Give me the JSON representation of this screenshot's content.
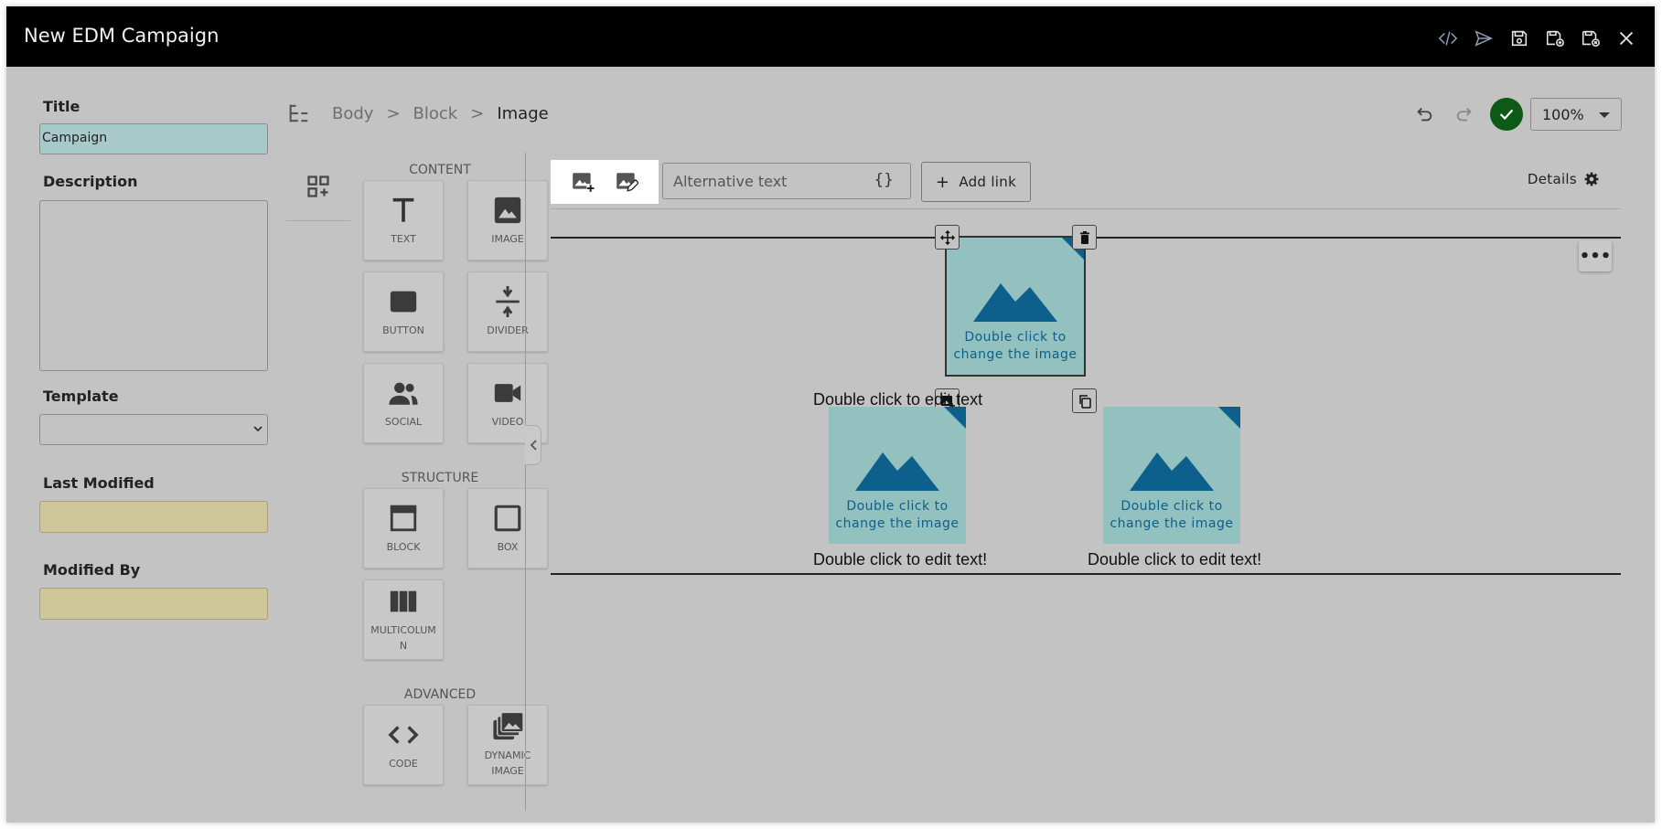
{
  "window": {
    "title": "New EDM Campaign"
  },
  "titlebar_icons": [
    "code-icon",
    "send-icon",
    "save-icon",
    "save-as-icon",
    "save-close-icon",
    "close-icon"
  ],
  "form": {
    "title_label": "Title",
    "title_value": "Campaign",
    "description_label": "Description",
    "description_value": "",
    "template_label": "Template",
    "template_value": "",
    "last_modified_label": "Last Modified",
    "last_modified_value": "",
    "modified_by_label": "Modified By",
    "modified_by_value": ""
  },
  "breadcrumb": {
    "items": [
      "Body",
      "Block",
      "Image"
    ],
    "separator": ">"
  },
  "zoom": {
    "value": "100%"
  },
  "palette": {
    "content_title": "CONTENT",
    "structure_title": "STRUCTURE",
    "advanced_title": "ADVANCED",
    "content": [
      {
        "label": "TEXT",
        "icon": "text-icon"
      },
      {
        "label": "IMAGE",
        "icon": "image-icon"
      },
      {
        "label": "BUTTON",
        "icon": "button-icon"
      },
      {
        "label": "DIVIDER",
        "icon": "divider-icon"
      },
      {
        "label": "SOCIAL",
        "icon": "social-icon"
      },
      {
        "label": "VIDEO",
        "icon": "video-icon"
      }
    ],
    "structure": [
      {
        "label": "BLOCK",
        "icon": "block-icon"
      },
      {
        "label": "BOX",
        "icon": "box-icon"
      },
      {
        "label": "MULTICOLUM",
        "label2": "N",
        "icon": "multicolumn-icon"
      }
    ],
    "advanced": [
      {
        "label": "CODE",
        "icon": "code-icon"
      },
      {
        "label": "DYNAMIC",
        "label2": "IMAGE",
        "icon": "dynamic-image-icon"
      }
    ]
  },
  "image_toolbar": {
    "alt_placeholder": "Alternative text",
    "braces": "{}",
    "add_link": "Add link",
    "add_link_plus": "+",
    "details": "Details"
  },
  "canvas": {
    "image_label_1": "Double click to",
    "image_label_2": "change the image",
    "text_1": "Double click to edit text",
    "text_2": "Double click to edit text!",
    "text_3": "Double click to edit text!",
    "more": "•••"
  },
  "colors": {
    "titlebar": "#000000",
    "background": "#c3c3c3",
    "accent_green": "#0c5a16",
    "image_placeholder": "#93c1bf",
    "image_icon": "#0d5f8c",
    "title_input": "#a7c9c9",
    "readonly_field": "#cdc79a"
  }
}
